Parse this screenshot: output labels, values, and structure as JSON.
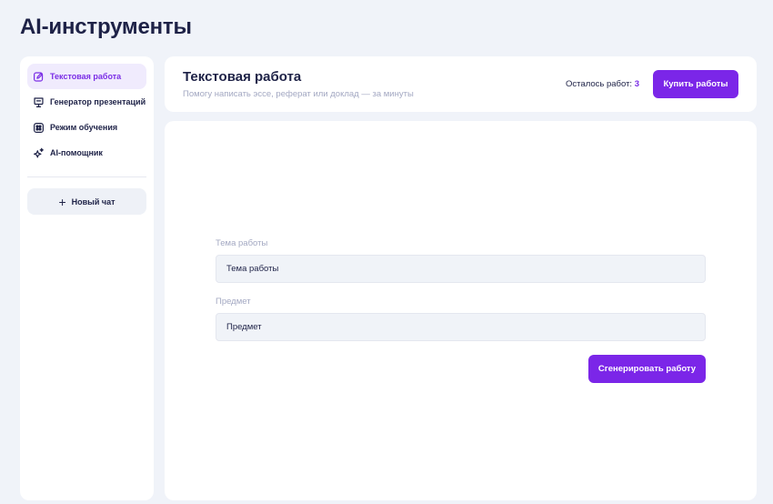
{
  "page": {
    "title": "AI-инструменты"
  },
  "sidebar": {
    "items": [
      {
        "label": "Текстовая работа",
        "icon": "edit-document-icon",
        "active": true
      },
      {
        "label": "Генератор презентаций",
        "icon": "presentation-icon",
        "active": false
      },
      {
        "label": "Режим обучения",
        "icon": "grid-book-icon",
        "active": false
      },
      {
        "label": "AI-помощник",
        "icon": "sparkles-icon",
        "active": false
      }
    ],
    "new_chat_label": "Новый чат",
    "new_chat_icon": "plus-icon"
  },
  "header": {
    "title": "Текстовая работа",
    "subtitle": "Помогу написать эссе, реферат или доклад — за минуты",
    "remaining_label": "Осталось работ:",
    "remaining_count": "3",
    "buy_button": "Купить работы"
  },
  "form": {
    "topic_label": "Тема работы",
    "topic_placeholder": "Тема работы",
    "subject_label": "Предмет",
    "subject_placeholder": "Предмет",
    "generate_button": "Сгенерировать работу"
  },
  "colors": {
    "accent": "#7b26e8",
    "background": "#f0f3f9",
    "card": "#ffffff",
    "text": "#1e2247",
    "muted": "#a3a8c2"
  }
}
